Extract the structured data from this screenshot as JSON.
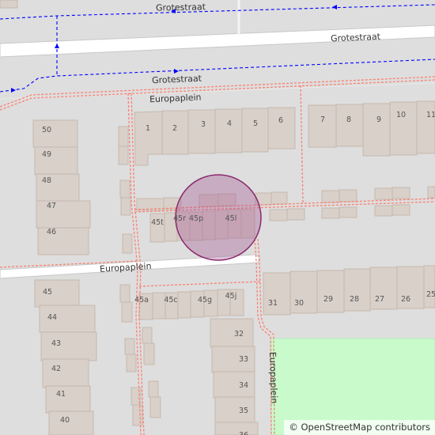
{
  "map": {
    "streets": {
      "grotestraat_footway_top": "Grotestraat",
      "grotestraat_road": "Grotestraat",
      "grotestraat_footway_bottom": "Grotestraat",
      "europaplein_north": "Europaplein",
      "europaplein_west": "Europaplein",
      "europaplein_east": "Europaplein"
    },
    "house_numbers": {
      "n1": "1",
      "n2": "2",
      "n3": "3",
      "n4": "4",
      "n5": "5",
      "n6": "6",
      "n7": "7",
      "n8": "8",
      "n9": "9",
      "n10": "10",
      "n11": "11",
      "n50": "50",
      "n49": "49",
      "n48": "48",
      "n47": "47",
      "n46": "46",
      "n45t": "45t",
      "n45r": "45r",
      "n45p": "45p",
      "n45l": "45l",
      "n45a": "45a",
      "n45c": "45c",
      "n45g": "45g",
      "n45j": "45j",
      "n45": "45",
      "n44": "44",
      "n43": "43",
      "n42": "42",
      "n41": "41",
      "n40": "40",
      "n31": "31",
      "n30": "30",
      "n29": "29",
      "n28": "28",
      "n27": "27",
      "n26": "26",
      "n25": "25",
      "n32": "32",
      "n33": "33",
      "n34": "34",
      "n35": "35",
      "n36": "36"
    },
    "colors": {
      "background": "#dedede",
      "building": "#d9d0c9",
      "building_stroke": "#c5b9af",
      "road": "#ffffff",
      "footway": "#fa8072",
      "cycleway": "#0000ff",
      "park": "#c8facc",
      "marker_fill": "#a0508c",
      "marker_stroke": "#8b2a6d"
    },
    "marker": {
      "type": "location-circle"
    },
    "attribution": {
      "symbol": "©",
      "text": "OpenStreetMap contributors"
    }
  }
}
